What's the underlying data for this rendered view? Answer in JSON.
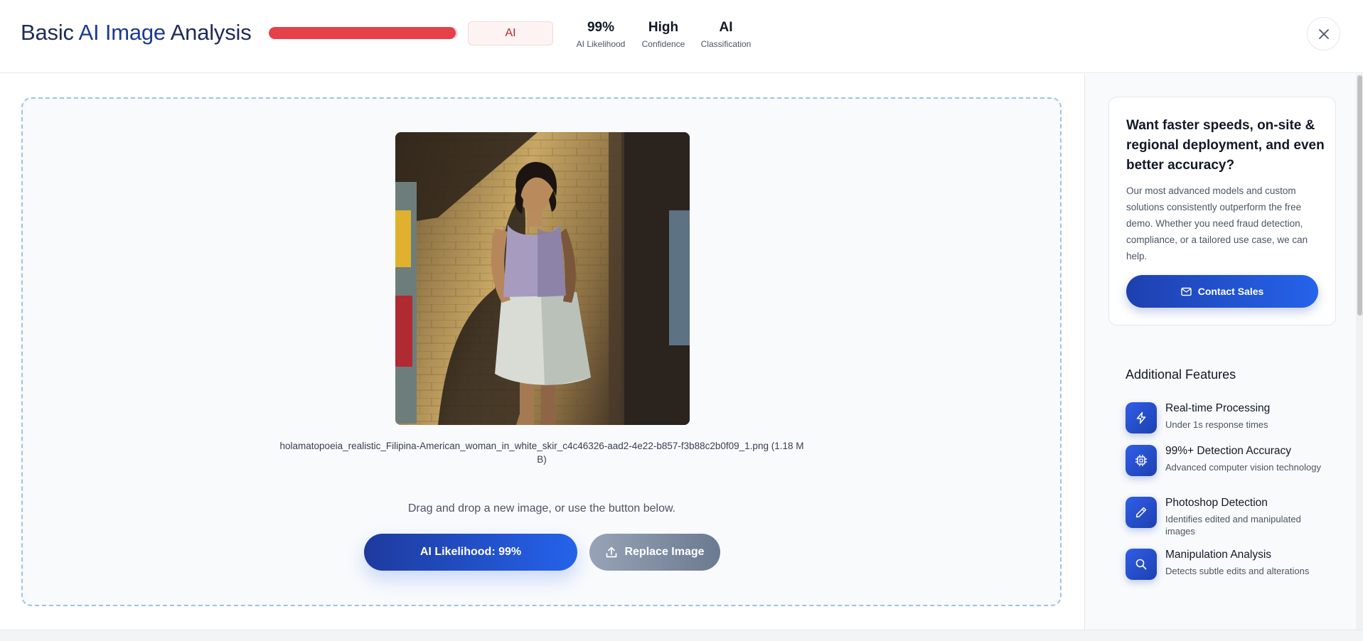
{
  "header": {
    "title_prefix": "Basic ",
    "title_accent": "AI Image",
    "title_suffix": " Analysis",
    "ai_likelihood_fraction": 0.99,
    "classification_badge": "AI",
    "stats": [
      {
        "value": "99%",
        "label": "AI Likelihood"
      },
      {
        "value": "High",
        "label": "Confidence"
      },
      {
        "value": "AI",
        "label": "Classification"
      }
    ],
    "close_icon": "close-icon"
  },
  "main": {
    "filename": "holamatopoeia_realistic_Filipina-American_woman_in_white_skir_c4c46326-aad2-4e22-b857-f3b88c2b0f09_1.png (1.18 MB)",
    "drag_hint": "Drag and drop a new image, or use the button below.",
    "primary_button": "AI Likelihood: 99%",
    "replace_button": "Replace Image",
    "replace_icon": "upload-icon"
  },
  "sidebar": {
    "cta": {
      "heading": "Want faster speeds, on-site & regional deployment, and even better accuracy?",
      "text": "Our most advanced models and custom solutions consistently outperform the free demo. Whether you need fraud detection, compliance, or a tailored use case, we can help.",
      "button": "Contact Sales",
      "button_icon": "mail-icon"
    },
    "features_title": "Additional Features",
    "features": [
      {
        "icon": "bolt-icon",
        "title": "Real-time Processing",
        "desc": "Under 1s response times"
      },
      {
        "icon": "chip-icon",
        "title": "99%+ Detection Accuracy",
        "desc": "Advanced computer vision technology"
      },
      {
        "icon": "pencil-icon",
        "title": "Photoshop Detection",
        "desc": "Identifies edited and manipulated images"
      },
      {
        "icon": "search-icon",
        "title": "Manipulation Analysis",
        "desc": "Detects subtle edits and alterations"
      }
    ]
  },
  "colors": {
    "ai_red": "#e5414a",
    "primary_blue": "#2563eb",
    "navy": "#1e2a5a"
  }
}
